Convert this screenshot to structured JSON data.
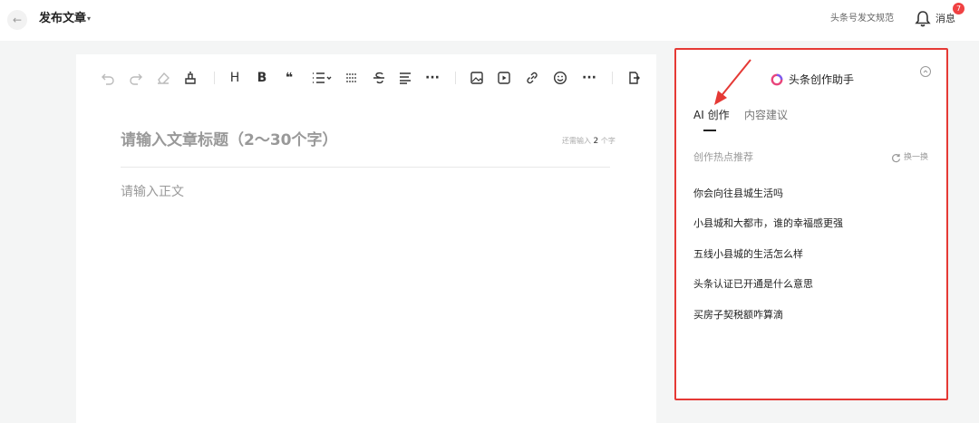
{
  "header": {
    "back_icon": "arrow-left-icon",
    "title": "发布文章",
    "title_caret": "▾",
    "guideline_link": "头条号发文规范",
    "notification_badge": "7",
    "messages_label": "消息"
  },
  "editor": {
    "toolbar_icons": [
      "undo-icon",
      "redo-icon",
      "eraser-icon",
      "format-painter-icon",
      "heading-icon",
      "bold-icon",
      "quote-icon",
      "list-icon",
      "divider-icon",
      "strikethrough-icon",
      "align-icon",
      "more-icon",
      "image-icon",
      "video-icon",
      "link-icon",
      "emoji-icon",
      "more-icon",
      "insert-file-icon"
    ],
    "heading_label": "H",
    "bold_label": "B",
    "quote_label": "❝",
    "more_label": "···",
    "title_placeholder": "请输入文章标题（2～30个字）",
    "counter_prefix": "还需输入",
    "counter_number": "2",
    "counter_suffix": "个字",
    "body_placeholder": "请输入正文"
  },
  "assistant": {
    "title": "头条创作助手",
    "tabs": [
      {
        "label": "AI 创作",
        "active": true
      },
      {
        "label": "内容建议",
        "active": false
      }
    ],
    "section_title": "创作热点推荐",
    "refresh_label": "换一换",
    "topics": [
      "你会向往县城生活吗",
      "小县城和大都市，谁的幸福感更强",
      "五线小县城的生活怎么样",
      "头条认证已开通是什么意思",
      "买房子契税额咋算滴"
    ]
  },
  "colors": {
    "highlight_border": "#e53935",
    "badge": "#f04142",
    "page_background": "#f4f5f5"
  }
}
